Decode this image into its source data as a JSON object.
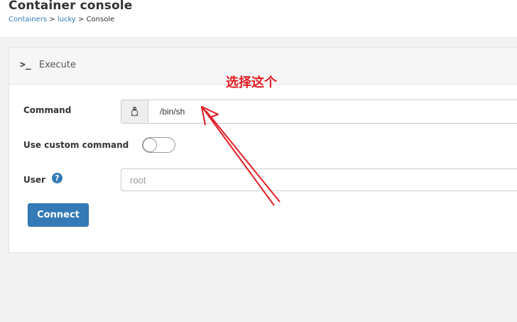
{
  "header": {
    "title": "Container console",
    "breadcrumb": {
      "containers": "Containers",
      "container": "lucky",
      "sep": ">",
      "current": "Console"
    }
  },
  "panel": {
    "icon": ">_",
    "title": "Execute",
    "command": {
      "label": "Command",
      "value": "/bin/sh",
      "os_icon": "linux-penguin-icon"
    },
    "custom_command": {
      "label": "Use custom command",
      "enabled": false
    },
    "user": {
      "label": "User",
      "help_glyph": "?",
      "placeholder": "root"
    },
    "connect_label": "Connect"
  },
  "annotation": {
    "text": "选择这个",
    "color": "#e21d23"
  },
  "colors": {
    "primary": "#337ab7",
    "link": "#337ab7"
  }
}
